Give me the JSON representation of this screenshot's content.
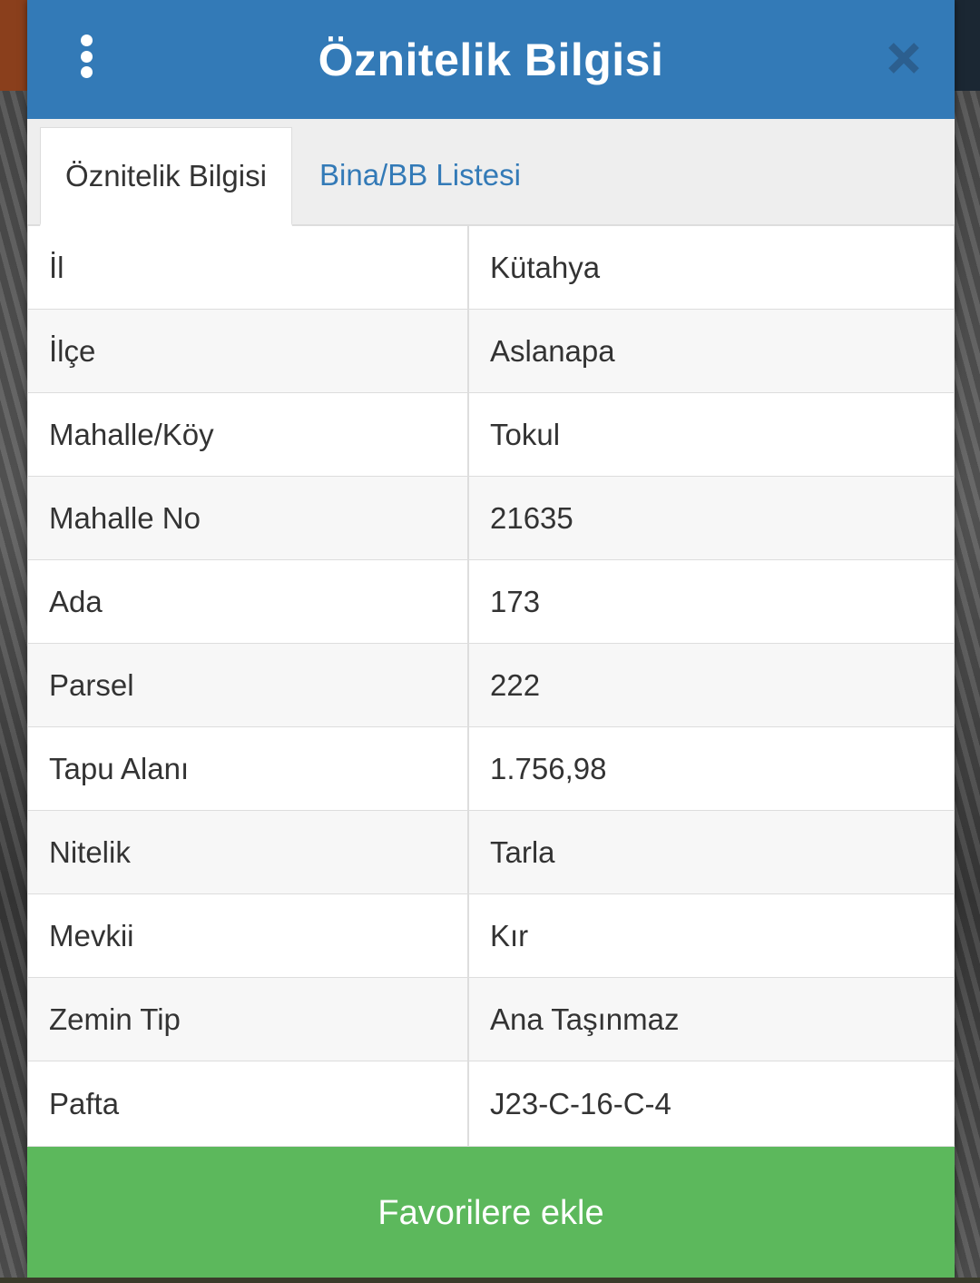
{
  "dialog": {
    "title": "Öznitelik Bilgisi"
  },
  "tabs": [
    {
      "label": "Öznitelik Bilgisi",
      "active": true
    },
    {
      "label": "Bina/BB Listesi",
      "active": false
    }
  ],
  "attributes": [
    {
      "key": "İl",
      "value": "Kütahya"
    },
    {
      "key": "İlçe",
      "value": "Aslanapa"
    },
    {
      "key": "Mahalle/Köy",
      "value": "Tokul"
    },
    {
      "key": "Mahalle No",
      "value": "21635"
    },
    {
      "key": "Ada",
      "value": "173"
    },
    {
      "key": "Parsel",
      "value": "222"
    },
    {
      "key": "Tapu Alanı",
      "value": "1.756,98"
    },
    {
      "key": "Nitelik",
      "value": "Tarla"
    },
    {
      "key": "Mevkii",
      "value": "Kır"
    },
    {
      "key": "Zemin Tip",
      "value": "Ana Taşınmaz"
    },
    {
      "key": "Pafta",
      "value": "J23-C-16-C-4"
    }
  ],
  "actions": {
    "favorite_label": "Favorilere ekle"
  },
  "icons": {
    "menu": "vertical-dots-icon",
    "close": "close-icon"
  },
  "colors": {
    "header": "#337ab7",
    "tab_link": "#337ab7",
    "favorite_button": "#5cb85c"
  }
}
